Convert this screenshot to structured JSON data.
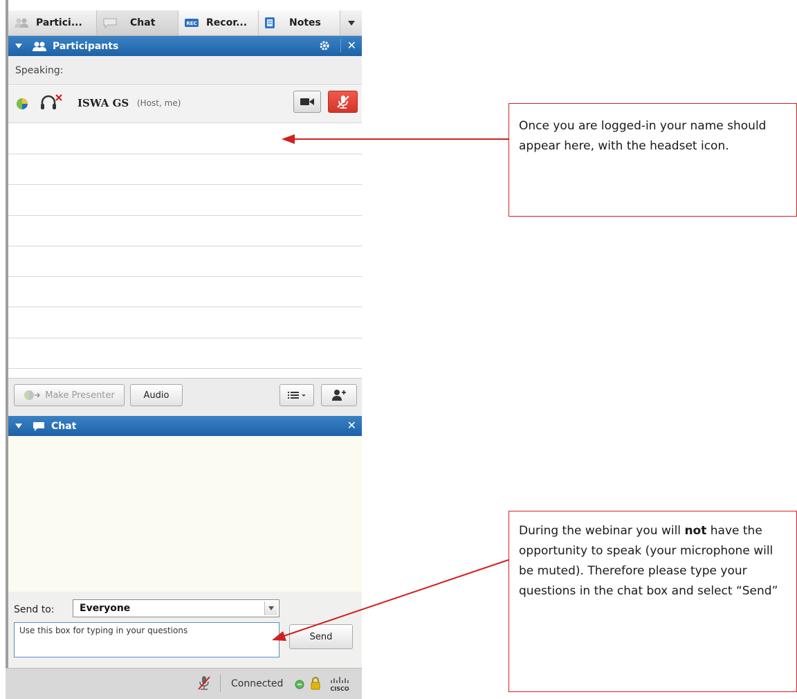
{
  "tabs": [
    {
      "label": "Partici..."
    },
    {
      "label": "Chat"
    },
    {
      "label": "Recor..."
    },
    {
      "label": "Notes"
    }
  ],
  "participants_panel": {
    "title": "Participants",
    "speaking_label": "Speaking:",
    "me": {
      "name": "ISWA GS",
      "role": "(Host, me)"
    },
    "toolbar": {
      "make_presenter": "Make Presenter",
      "audio": "Audio"
    }
  },
  "chat_panel": {
    "title": "Chat",
    "send_to_label": "Send to:",
    "send_to_value": "Everyone",
    "input_text": "Use this box for typing in your questions",
    "send_button": "Send"
  },
  "status_bar": {
    "connection": "Connected"
  },
  "annotations": {
    "login": "Once you are logged-in your name should appear here, with the headset icon.",
    "speak_part1": "During the webinar you will ",
    "speak_bold": "not",
    "speak_part2": " have the opportunity to speak (your microphone will be muted). Therefore please type your questions in the chat box and select “Send”"
  },
  "colors": {
    "panel_header": "#1e62a8",
    "annotation_red": "#d21f1f",
    "mute_red": "#d4342a"
  }
}
